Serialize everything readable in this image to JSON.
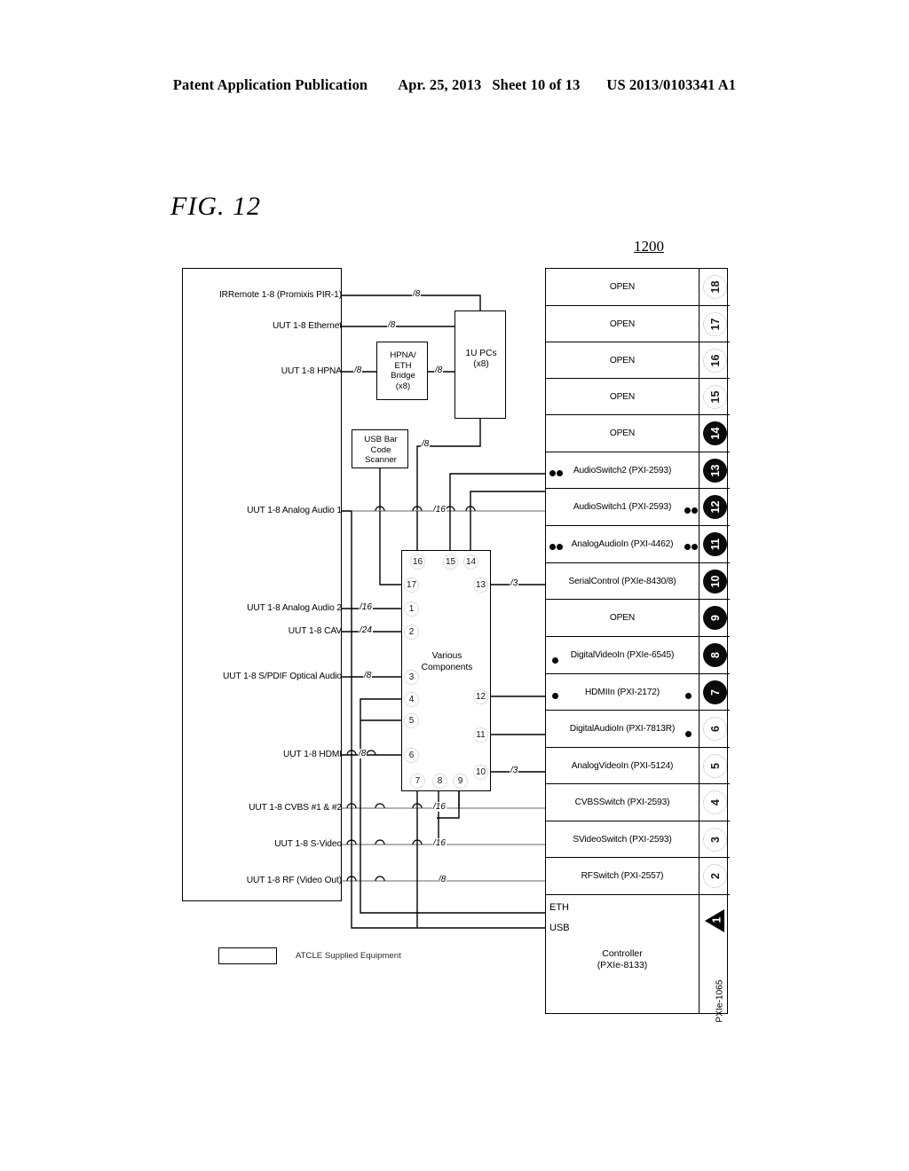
{
  "header": {
    "publication": "Patent Application Publication",
    "date": "Apr. 25, 2013",
    "sheet": "Sheet 10 of 13",
    "docnum": "US 2013/0103341 A1"
  },
  "figure": {
    "label": "FIG. 12",
    "reference_numeral": "1200"
  },
  "uut_panel": {
    "signals": [
      {
        "label": "IRRemote 1-8 (Promixis PIR-1)",
        "bus": "/8"
      },
      {
        "label": "UUT 1-8 Ethernet",
        "bus": "/8"
      },
      {
        "label": "UUT 1-8 HPNA",
        "bus": "/8"
      },
      {
        "label": "UUT 1-8 Analog Audio 1",
        "bus": "/16"
      },
      {
        "label": "UUT 1-8 Analog Audio 2",
        "bus": "/16"
      },
      {
        "label": "UUT 1-8 CAV",
        "bus": "/24"
      },
      {
        "label": "UUT 1-8 S/PDIF Optical Audio",
        "bus": "/8"
      },
      {
        "label": "UUT 1-8 HDMI",
        "bus": "/8"
      },
      {
        "label": "UUT 1-8 CVBS #1 & #2",
        "bus": "/16"
      },
      {
        "label": "UUT 1-8 S-Video",
        "bus": "/16"
      },
      {
        "label": "UUT 1-8 RF (Video Out)",
        "bus": "/8"
      }
    ]
  },
  "blocks": {
    "bridge": "HPNA/\nETH\nBridge\n(x8)",
    "pcs": "1U PCs\n(x8)",
    "usb_scanner": "USB Bar\nCode\nScanner",
    "various_components": "Various\nComponents",
    "usb_bus": "/8"
  },
  "various_components_ports": {
    "top": [
      "16",
      "15",
      "14"
    ],
    "left": [
      "17",
      "1",
      "2",
      "3",
      "4",
      "5",
      "6"
    ],
    "bottom": [
      "7",
      "8",
      "9"
    ],
    "right": [
      "13",
      "12",
      "11",
      "10"
    ],
    "right_buses": {
      "13": "/3",
      "10": "/3"
    }
  },
  "chassis": {
    "model": "PXIe-1065",
    "slots": [
      {
        "num": "18",
        "label": "OPEN",
        "style": "open"
      },
      {
        "num": "17",
        "label": "OPEN",
        "style": "open"
      },
      {
        "num": "16",
        "label": "OPEN",
        "style": "open"
      },
      {
        "num": "15",
        "label": "OPEN",
        "style": "open"
      },
      {
        "num": "14",
        "label": "OPEN",
        "style": "filled"
      },
      {
        "num": "13",
        "label": "AudioSwitch2 (PXI-2593)",
        "style": "filled"
      },
      {
        "num": "12",
        "label": "AudioSwitch1 (PXI-2593)",
        "style": "filled"
      },
      {
        "num": "11",
        "label": "AnalogAudioIn (PXI-4462)",
        "style": "filled"
      },
      {
        "num": "10",
        "label": "SerialControl (PXIe-8430/8)",
        "style": "filled"
      },
      {
        "num": "9",
        "label": "OPEN",
        "style": "filled"
      },
      {
        "num": "8",
        "label": "DigitalVideoIn (PXIe-6545)",
        "style": "filled"
      },
      {
        "num": "7",
        "label": "HDMIIn (PXI-2172)",
        "style": "filled"
      },
      {
        "num": "6",
        "label": "DigitalAudioIn (PXI-7813R)",
        "style": "open"
      },
      {
        "num": "5",
        "label": "AnalogVideoIn (PXI-5124)",
        "style": "open"
      },
      {
        "num": "4",
        "label": "CVBSSwitch (PXI-2593)",
        "style": "open"
      },
      {
        "num": "3",
        "label": "SVideoSwitch (PXI-2593)",
        "style": "open"
      },
      {
        "num": "2",
        "label": "RFSwitch (PXI-2557)",
        "style": "open"
      }
    ],
    "controller": {
      "num": "1",
      "style": "triangle",
      "ports": [
        "ETH",
        "USB"
      ],
      "name": "Controller\n(PXIe-8133)"
    }
  },
  "legend": {
    "text": "ATCLE Supplied Equipment"
  }
}
